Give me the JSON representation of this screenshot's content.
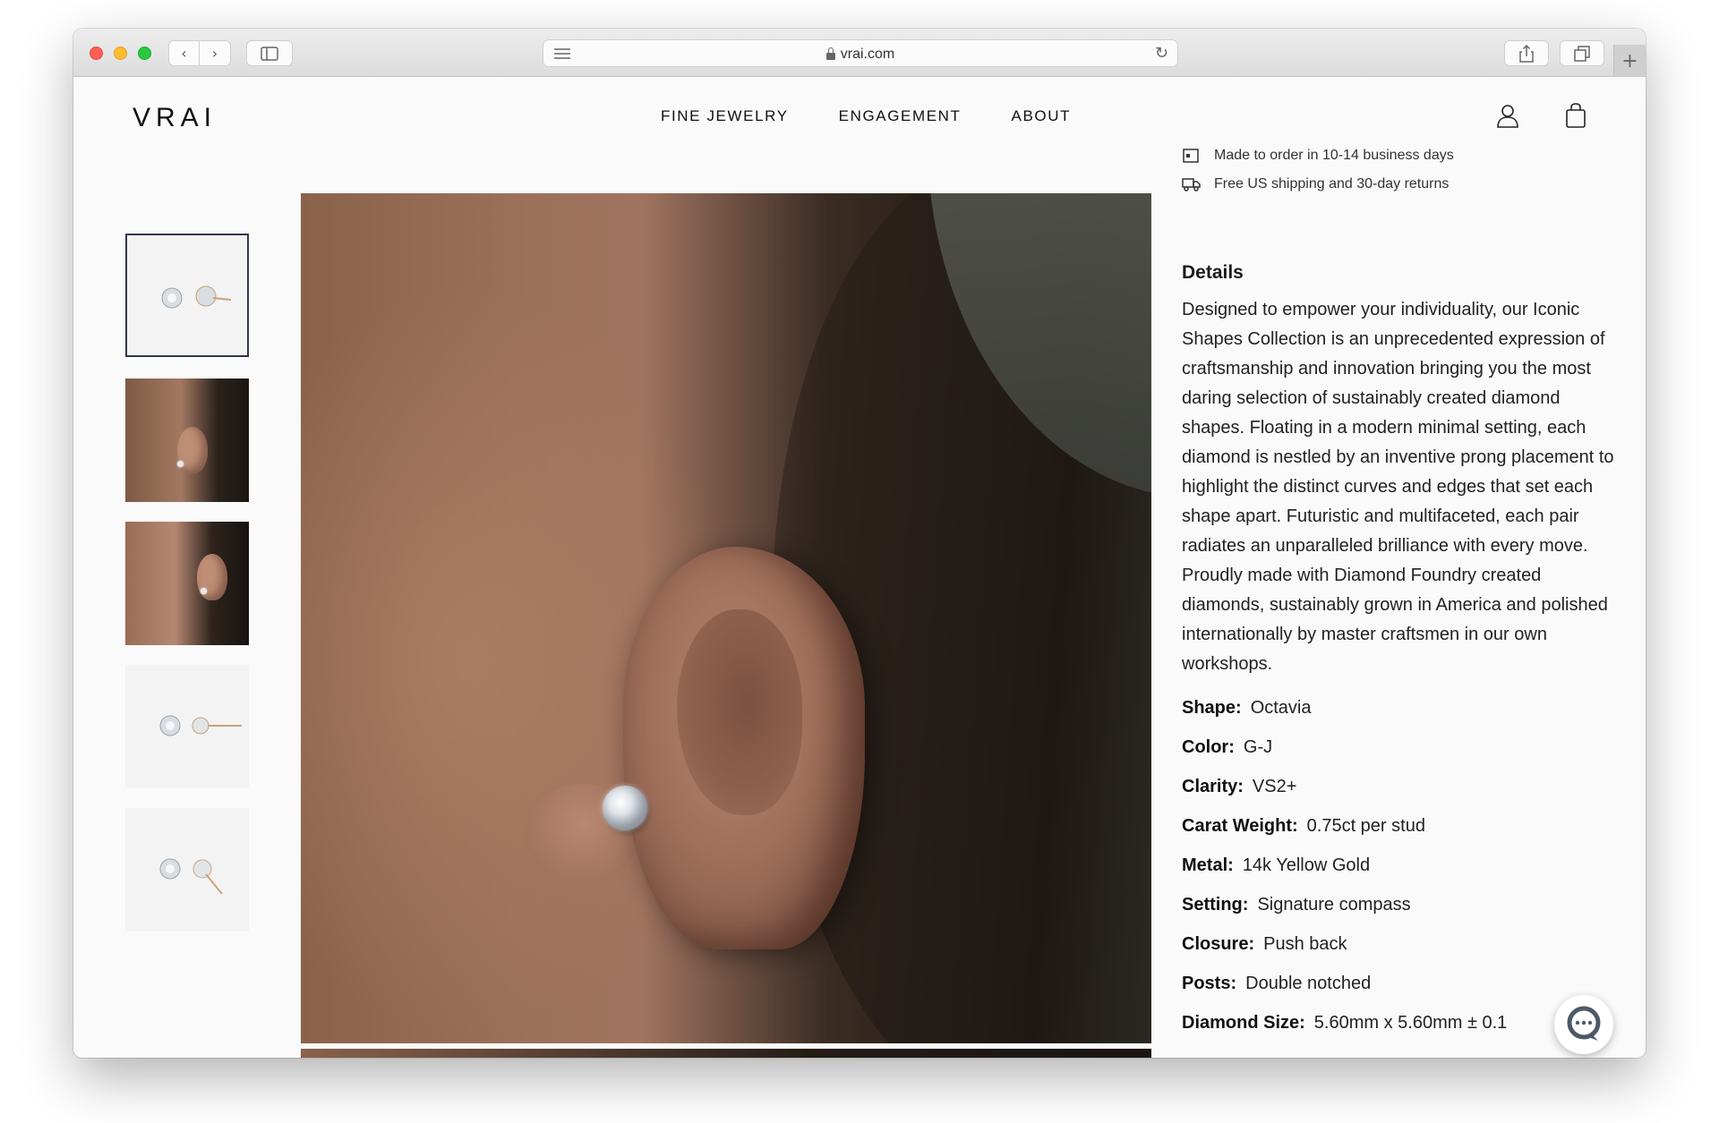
{
  "browser": {
    "url": "vrai.com",
    "back_glyph": "‹",
    "forward_glyph": "›",
    "reload_glyph": "↻",
    "newtab_glyph": "+"
  },
  "header": {
    "logo": "VRAI",
    "nav": [
      "FINE JEWELRY",
      "ENGAGEMENT",
      "ABOUT"
    ],
    "icons": [
      "user-icon",
      "bag-icon"
    ]
  },
  "gallery": {
    "thumbnails": [
      "product-top",
      "model-side",
      "model-side-2",
      "product-side",
      "product-angle"
    ],
    "selected_index": 0
  },
  "product": {
    "features": [
      {
        "icon": "calendar-icon",
        "text": "Made to order in 10-14 business days"
      },
      {
        "icon": "truck-icon",
        "text": "Free US shipping and 30-day returns"
      }
    ],
    "details_title": "Details",
    "description": "Designed to empower your individuality, our Iconic Shapes Collection is an unprecedented expression of craftsmanship and innovation bringing you the most daring selection of sustainably created diamond shapes. Floating in a modern minimal setting, each diamond is nestled by an inventive prong placement to highlight the distinct curves and edges that set each shape apart. Futuristic and multifaceted, each pair radiates an unparalleled brilliance with every move. Proudly made with Diamond Foundry created diamonds, sustainably grown in America and polished internationally by master craftsmen in our own workshops.",
    "specs": [
      {
        "label": "Shape:",
        "value": "Octavia"
      },
      {
        "label": "Color:",
        "value": "G-J"
      },
      {
        "label": "Clarity:",
        "value": "VS2+"
      },
      {
        "label": "Carat Weight:",
        "value": "0.75ct per stud"
      },
      {
        "label": "Metal:",
        "value": "14k Yellow Gold"
      },
      {
        "label": "Setting:",
        "value": "Signature compass"
      },
      {
        "label": "Closure:",
        "value": "Push back"
      },
      {
        "label": "Posts:",
        "value": "Double notched"
      },
      {
        "label": "Diamond Size:",
        "value": "5.60mm x 5.60mm ± 0.1"
      }
    ]
  },
  "chat": {
    "icon": "chat-bubble-icon"
  }
}
